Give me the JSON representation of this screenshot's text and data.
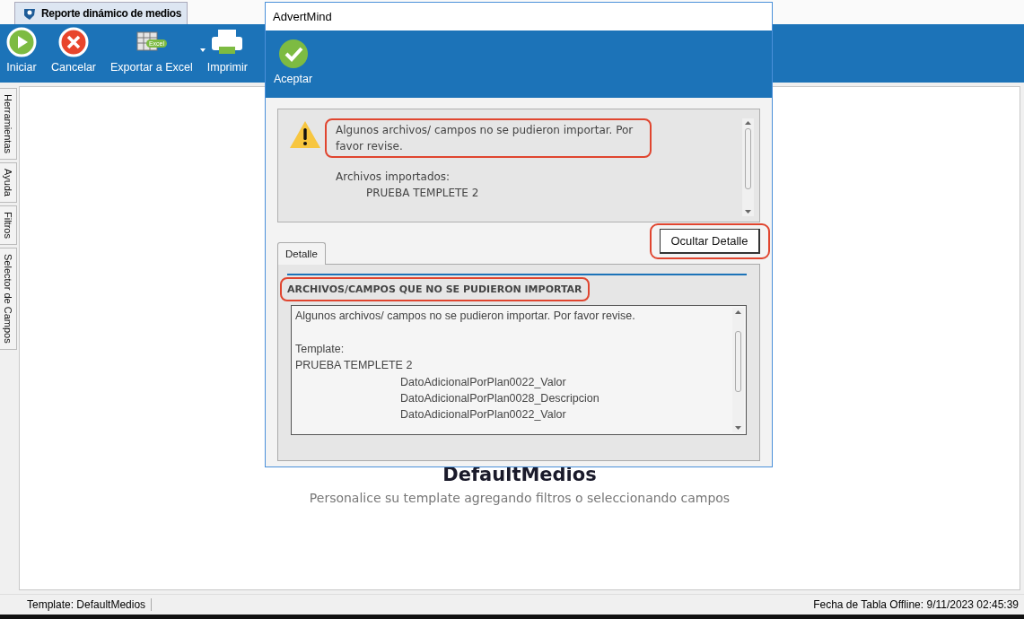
{
  "app_tab": {
    "label": "Reporte dinámico de medios"
  },
  "toolbar": [
    {
      "kind": "play",
      "label": "Iniciar"
    },
    {
      "kind": "cancel",
      "label": "Cancelar"
    },
    {
      "kind": "excel",
      "label": "Exportar a Excel",
      "badge": "Excel",
      "dropdown": true
    },
    {
      "kind": "print",
      "label": "Imprimir"
    }
  ],
  "side_tabs": [
    {
      "label": "Herramientas"
    },
    {
      "label": "Ayuda"
    },
    {
      "label": "Filtros"
    },
    {
      "label": "Selector de Campos"
    }
  ],
  "content": {
    "title": "DefaultMedios",
    "subtitle": "Personalice su template agregando filtros o seleccionando campos"
  },
  "status_bar": {
    "left": "Template: DefaultMedios",
    "right": "Fecha de Tabla Offline: 9/11/2023 02:45:39"
  },
  "dialog": {
    "title": "AdvertMind",
    "toolbar": [
      {
        "kind": "accept",
        "label": "Aceptar"
      }
    ],
    "message": {
      "text": "Algunos archivos/ campos no se pudieron importar. Por favor revise.",
      "highlighted": true,
      "imported_label": "Archivos importados:",
      "imported_files": [
        "PRUEBA TEMPLETE 2"
      ]
    },
    "toggle_button": {
      "label": "Ocultar Detalle",
      "highlighted": true
    },
    "tabs": [
      {
        "label": "Detalle",
        "selected": true
      }
    ],
    "detail": {
      "heading": "ARCHIVOS/CAMPOS QUE NO SE PUDIERON IMPORTAR",
      "highlighted": true,
      "intro": "Algunos archivos/ campos no se pudieron importar. Por favor revise.",
      "template_label": "Template:",
      "templates": [
        {
          "name": "PRUEBA TEMPLETE 2",
          "children": [
            "DatoAdicionalPorPlan0022_Valor",
            "DatoAdicionalPorPlan0028_Descripcion",
            "DatoAdicionalPorPlan0022_Valor"
          ]
        }
      ]
    }
  }
}
